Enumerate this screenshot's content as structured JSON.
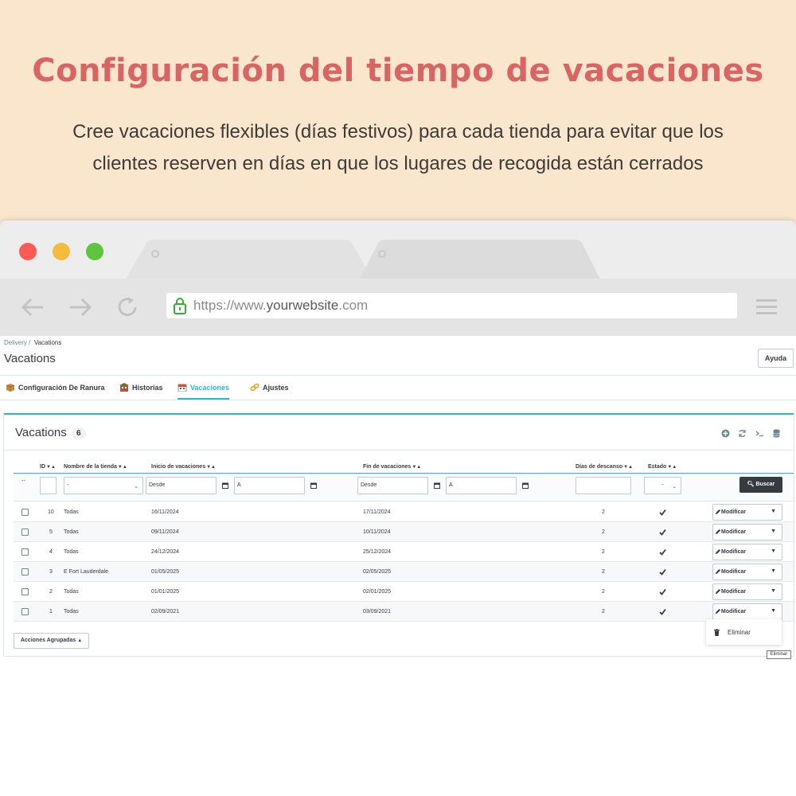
{
  "hero": {
    "title": "Configuración del tiempo de vacaciones",
    "subtitle_line1": "Cree vacaciones flexibles (días festivos) para cada tienda para evitar que los",
    "subtitle_line2": "clientes reserven en días en que los lugares de recogida están cerrados"
  },
  "browser": {
    "url_prefix": "https://www.",
    "url_domain": "yourwebsite",
    "url_suffix": ".com"
  },
  "admin": {
    "breadcrumb": {
      "parent": "Delivery",
      "separator": "/",
      "current": "Vacations"
    },
    "page_title": "Vacations",
    "help_label": "Ayuda",
    "tabs": [
      {
        "label": "Configuración De Ranura",
        "icon": "box-icon"
      },
      {
        "label": "Historias",
        "icon": "building-icon"
      },
      {
        "label": "Vacaciones",
        "icon": "calendar-icon",
        "active": true
      },
      {
        "label": "Ajustes",
        "icon": "link-icon"
      }
    ],
    "panel": {
      "title": "Vacations",
      "count": "6"
    },
    "columns": {
      "id": "ID",
      "store": "Nombre de la tienda",
      "start": "Inicio de vacaciones",
      "end": "Fin de vacaciones",
      "days": "Días de descanso",
      "status": "Estado"
    },
    "filters": {
      "row_marker": "--",
      "store_select": "-",
      "start_from": "Desde",
      "start_to": "A",
      "end_from": "Desde",
      "end_to": "A",
      "status_select": "-",
      "search_label": "Buscar"
    },
    "rows": [
      {
        "id": "10",
        "store": "Todas",
        "start": "16/11/2024",
        "end": "17/11/2024",
        "days": "2"
      },
      {
        "id": "5",
        "store": "Todas",
        "start": "09/11/2024",
        "end": "10/11/2024",
        "days": "2"
      },
      {
        "id": "4",
        "store": "Todas",
        "start": "24/12/2024",
        "end": "25/12/2024",
        "days": "2"
      },
      {
        "id": "3",
        "store": "E Fort Lauderdale",
        "start": "01/05/2025",
        "end": "02/05/2025",
        "days": "2"
      },
      {
        "id": "2",
        "store": "Todas",
        "start": "01/01/2025",
        "end": "02/01/2025",
        "days": "2"
      },
      {
        "id": "1",
        "store": "Todas",
        "start": "02/09/2021",
        "end": "03/09/2021",
        "days": "2"
      }
    ],
    "modify_label": "Modificar",
    "bulk_label": "Acciones Agrupadas",
    "dropdown_delete": "Eliminar",
    "tooltip": "Eliminar"
  },
  "colors": {
    "accent": "#25b9d7",
    "hero_bg": "#f9e6cd",
    "hero_title": "#d96464"
  }
}
